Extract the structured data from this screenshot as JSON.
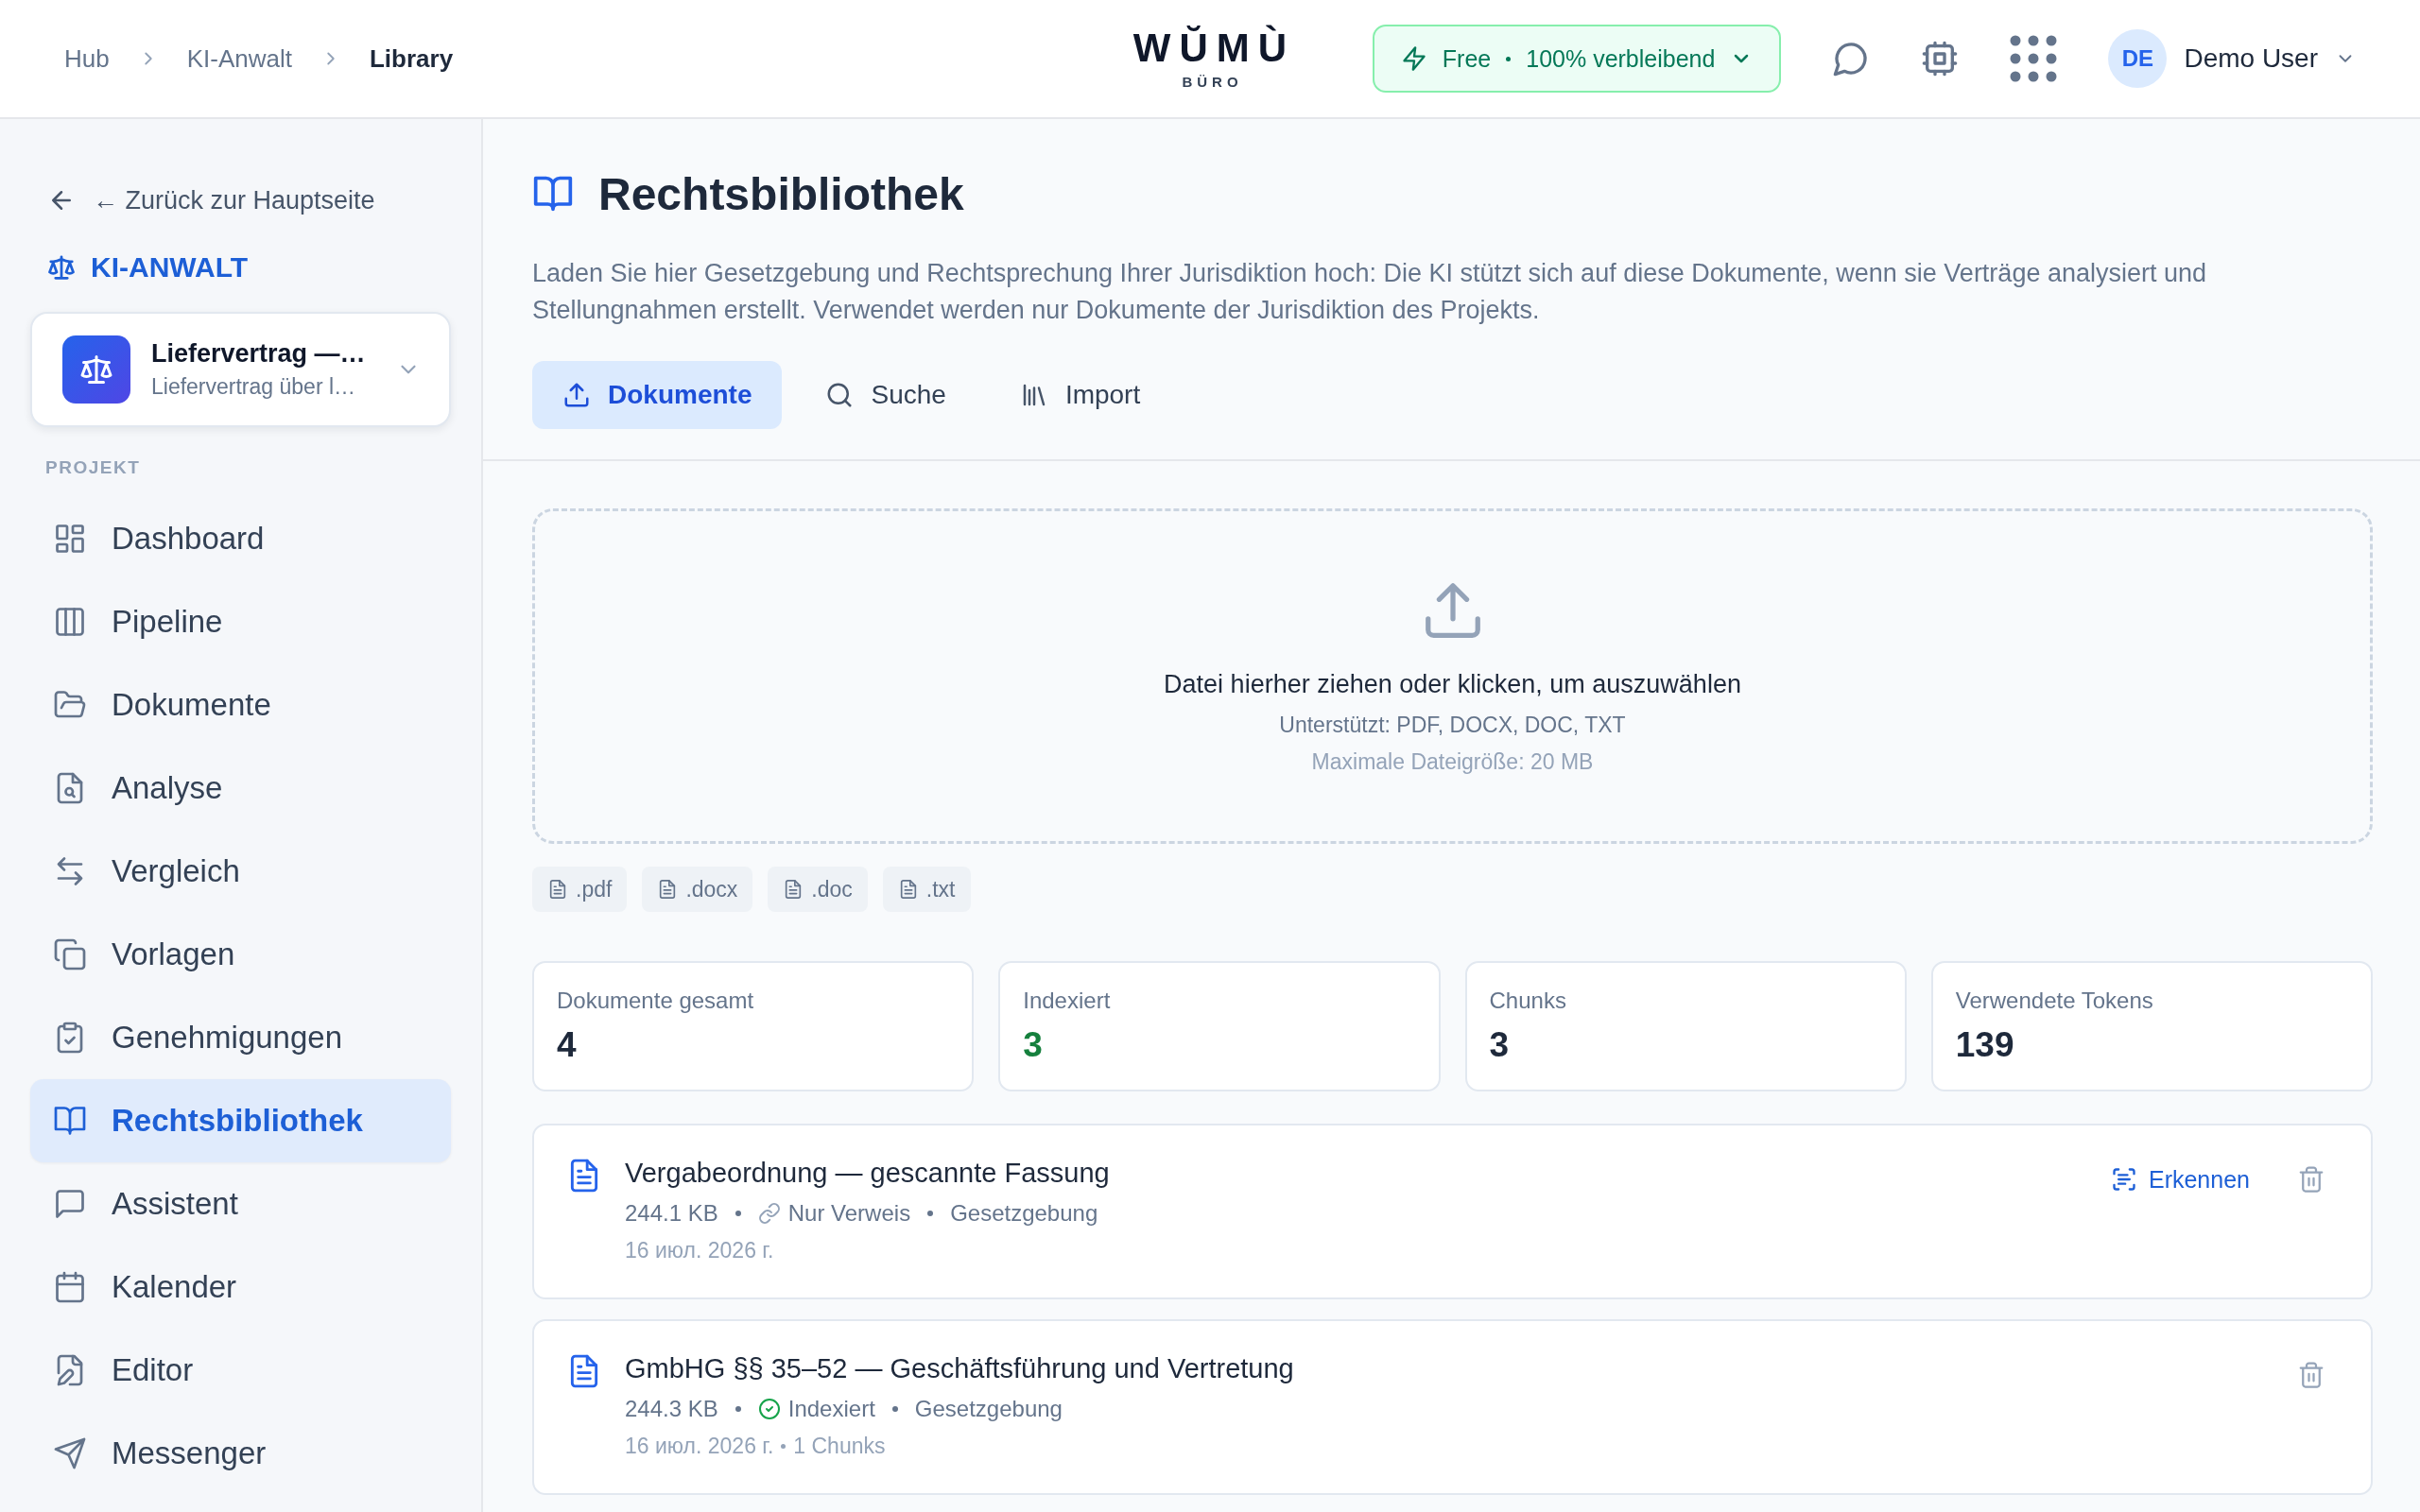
{
  "breadcrumbs": [
    {
      "label": "Hub",
      "current": false
    },
    {
      "label": "KI-Anwalt",
      "current": false
    },
    {
      "label": "Library",
      "current": true
    }
  ],
  "logo": {
    "title": "WŬMÙ",
    "subtitle": "BÜRO"
  },
  "plan": {
    "tier": "Free",
    "remaining": "100% verbleibend"
  },
  "user": {
    "initials": "DE",
    "name": "Demo User"
  },
  "sidebar": {
    "back_link": "← Zurück zur Hauptseite",
    "app_title": "KI-ANWALT",
    "project": {
      "name": "Liefervertrag —…",
      "subtitle": "Liefervertrag über l…"
    },
    "section_label": "PROJEKT",
    "items": [
      {
        "label": "Dashboard",
        "kind": "dashboard",
        "selected": false
      },
      {
        "label": "Pipeline",
        "kind": "columns",
        "selected": false
      },
      {
        "label": "Dokumente",
        "kind": "folder",
        "selected": false
      },
      {
        "label": "Analyse",
        "kind": "analysis",
        "selected": false
      },
      {
        "label": "Vergleich",
        "kind": "compare",
        "selected": false
      },
      {
        "label": "Vorlagen",
        "kind": "templates",
        "selected": false
      },
      {
        "label": "Genehmigungen",
        "kind": "approvals",
        "selected": false
      },
      {
        "label": "Rechtsbibliothek",
        "kind": "library",
        "selected": true
      },
      {
        "label": "Assistent",
        "kind": "assistant",
        "selected": false
      },
      {
        "label": "Kalender",
        "kind": "calendar",
        "selected": false
      },
      {
        "label": "Editor",
        "kind": "editor",
        "selected": false
      },
      {
        "label": "Messenger",
        "kind": "messenger",
        "selected": false
      }
    ]
  },
  "page": {
    "title": "Rechtsbibliothek",
    "description": "Laden Sie hier Gesetzgebung und Rechtsprechung Ihrer Jurisdiktion hoch: Die KI stützt sich auf diese Dokumente, wenn sie Verträge analysiert und Stellungnahmen erstellt. Verwendet werden nur Dokumente der Jurisdiktion des Projekts.",
    "tabs": [
      {
        "label": "Dokumente",
        "kind": "upload",
        "selected": true
      },
      {
        "label": "Suche",
        "kind": "search",
        "selected": false
      },
      {
        "label": "Import",
        "kind": "import",
        "selected": false
      }
    ],
    "upload": {
      "prompt": "Datei hierher ziehen oder klicken, um auszuwählen",
      "supported": "Unterstützt: PDF, DOCX, DOC, TXT",
      "max_size": "Maximale Dateigröße: 20 MB"
    },
    "file_types": [
      ".pdf",
      ".docx",
      ".doc",
      ".txt"
    ],
    "stats": [
      {
        "label": "Dokumente gesamt",
        "value": "4",
        "kind": "plain"
      },
      {
        "label": "Indexiert",
        "value": "3",
        "kind": "success"
      },
      {
        "label": "Chunks",
        "value": "3",
        "kind": "plain"
      },
      {
        "label": "Verwendete Tokens",
        "value": "139",
        "kind": "plain"
      }
    ],
    "documents": [
      {
        "title": "Vergabeordnung — gescannte Fassung",
        "size": "244.1 KB",
        "status": {
          "kind": "reference",
          "label": "Nur Verweis"
        },
        "category": "Gesetzgebung",
        "date": "16 июл. 2026 г.",
        "action": "Erkennen"
      },
      {
        "title": "GmbHG §§ 35–52 — Geschäftsführung und Vertretung",
        "size": "244.3 KB",
        "status": {
          "kind": "indexed",
          "label": "Indexiert"
        },
        "category": "Gesetzgebung",
        "date": "16 июл. 2026 г.",
        "chunks": "1 Chunks"
      }
    ]
  }
}
